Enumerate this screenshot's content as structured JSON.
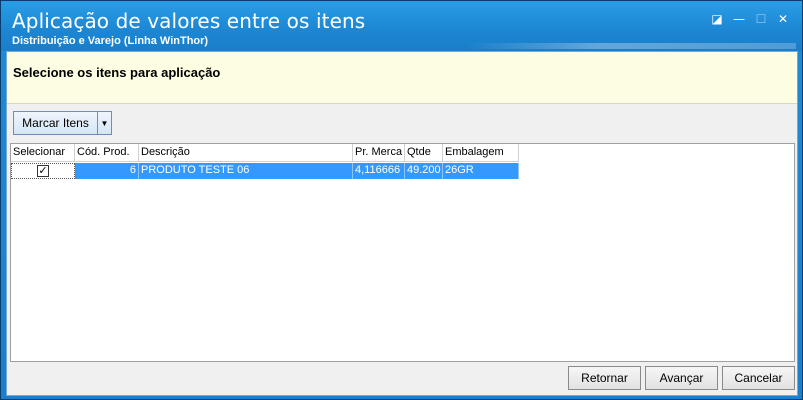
{
  "window": {
    "title": "Aplicação de valores entre os itens",
    "subtitle": "Distribuição e Varejo (Linha WinThor)",
    "controls": [
      {
        "name": "restore-icon",
        "glyph": "◪"
      },
      {
        "name": "minimize-icon",
        "glyph": "—"
      },
      {
        "name": "maximize-icon",
        "glyph": "☐"
      },
      {
        "name": "close-icon",
        "glyph": "✕"
      }
    ]
  },
  "header": {
    "text": "Selecione os itens para aplicação"
  },
  "toolbar": {
    "mark_items_label": "Marcar Itens",
    "dropdown_glyph": "▼"
  },
  "grid": {
    "columns": [
      "Selecionar",
      "Cód. Prod.",
      "Descrição",
      "Pr. Merca",
      "Qtde",
      "Embalagem"
    ],
    "rows": [
      {
        "selected": true,
        "check_glyph": "✓",
        "cod_prod": "6",
        "descricao": "PRODUTO TESTE 06",
        "pr_merca": "4,116666",
        "qtde": "49.200",
        "embalagem": "26GR"
      }
    ]
  },
  "footer": {
    "retornar_label": "Retornar",
    "avancar_label": "Avançar",
    "cancelar_label": "Cancelar"
  },
  "colors": {
    "accent": "#1c86d3",
    "selection": "#3399ff",
    "header_bg": "#fdfde3"
  }
}
